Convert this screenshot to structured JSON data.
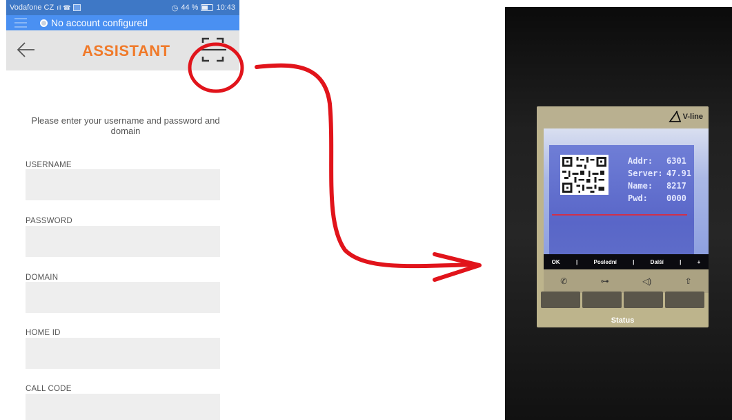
{
  "status_bar": {
    "carrier": "Vodafone CZ",
    "signal_icons": "ıll ☎",
    "alarm_icon": "◷",
    "battery_pct": "44 %",
    "battery_level": 0.44,
    "time": "10:43"
  },
  "account_bar": {
    "status_text": "No account configured"
  },
  "header": {
    "title": "ASSISTANT",
    "back_icon": "arrow-left",
    "qr_icon": "qr-scan"
  },
  "form": {
    "intro": "Please enter your username and password and domain",
    "fields": [
      {
        "label": "USERNAME",
        "value": ""
      },
      {
        "label": "PASSWORD",
        "value": ""
      },
      {
        "label": "DOMAIN",
        "value": ""
      },
      {
        "label": "HOME ID",
        "value": ""
      },
      {
        "label": "CALL CODE",
        "value": ""
      }
    ]
  },
  "annotation": {
    "color": "#e1141b"
  },
  "device_photo": {
    "brand": "V-line",
    "rows": [
      {
        "key": "Addr:",
        "value": "6301"
      },
      {
        "key": "Server:",
        "value": "47.91"
      },
      {
        "key": "Name:",
        "value": "8217"
      },
      {
        "key": "Pwd:",
        "value": "0000"
      }
    ],
    "softkeys": [
      "OK",
      "|",
      "Poslední",
      "|",
      "Další",
      "|",
      "+"
    ],
    "icons": [
      "phone-icon",
      "key-icon",
      "speaker-icon",
      "bell-icon"
    ],
    "footer": "Status"
  },
  "colors": {
    "status_bar_bg": "#3e78c6",
    "account_bar_bg": "#4a90f2",
    "title_color": "#f07a2a",
    "toolbar_bg": "#e4e4e4",
    "input_bg": "#eeeeee"
  }
}
